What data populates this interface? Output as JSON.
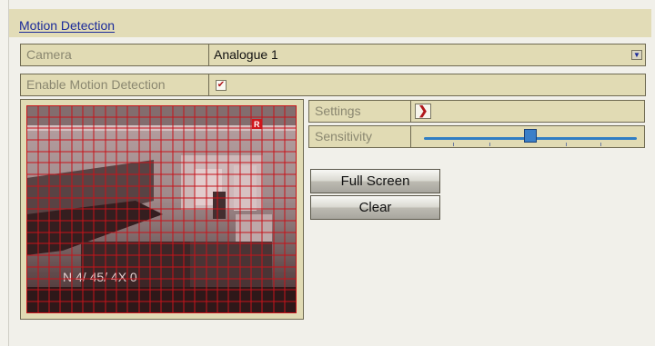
{
  "title": "Motion Detection",
  "camera": {
    "label": "Camera",
    "value": "Analogue 1"
  },
  "enable": {
    "label": "Enable Motion Detection",
    "checked": true
  },
  "video": {
    "marker": "R",
    "overlay_text": "N  4/ 45/ 4X  0"
  },
  "settings": {
    "label": "Settings"
  },
  "sensitivity": {
    "label": "Sensitivity",
    "level": 0.5
  },
  "buttons": {
    "full_screen": "Full Screen",
    "clear": "Clear"
  },
  "colors": {
    "grid": "#c8141b",
    "accent": "#2f7dc4",
    "panel": "#e1dbb4"
  }
}
